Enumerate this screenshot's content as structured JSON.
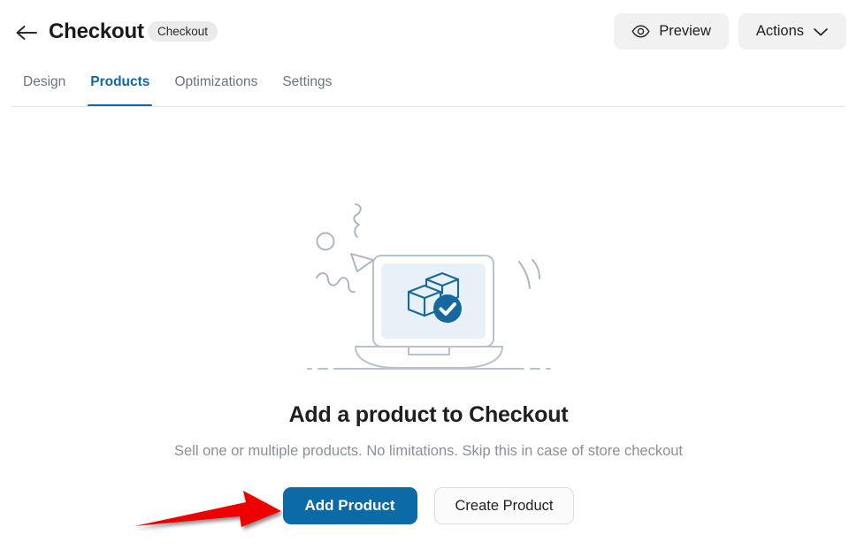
{
  "header": {
    "back_icon": "arrow-left-icon",
    "title": "Checkout",
    "badge": "Checkout",
    "preview_label": "Preview",
    "preview_icon": "eye-icon",
    "actions_label": "Actions",
    "actions_icon": "chevron-down-icon"
  },
  "tabs": [
    {
      "label": "Design",
      "active": false
    },
    {
      "label": "Products",
      "active": true
    },
    {
      "label": "Optimizations",
      "active": false
    },
    {
      "label": "Settings",
      "active": false
    }
  ],
  "empty_state": {
    "illustration": "laptop-with-product-boxes-check-illustration",
    "headline": "Add a product to Checkout",
    "subtitle": "Sell one or multiple products. No limitations. Skip this in case of store checkout",
    "primary_button": "Add Product",
    "secondary_button": "Create Product"
  },
  "annotation": {
    "arrow": "red-pointer-arrow",
    "points_at": "Add Product"
  },
  "colors": {
    "accent_blue": "#1168a8",
    "primary_button": "#0c6aa6",
    "badge_bg": "#ebebeb",
    "soft_button_bg": "#f1f1f1",
    "muted_text": "#6b7280",
    "subtitle_text": "#8a8f98",
    "illustration_line": "#a8b4c0",
    "illustration_screen": "#e8f1f8",
    "illustration_box": "#16699e",
    "annotation_red": "#ee0000",
    "background": "#ffffff"
  }
}
